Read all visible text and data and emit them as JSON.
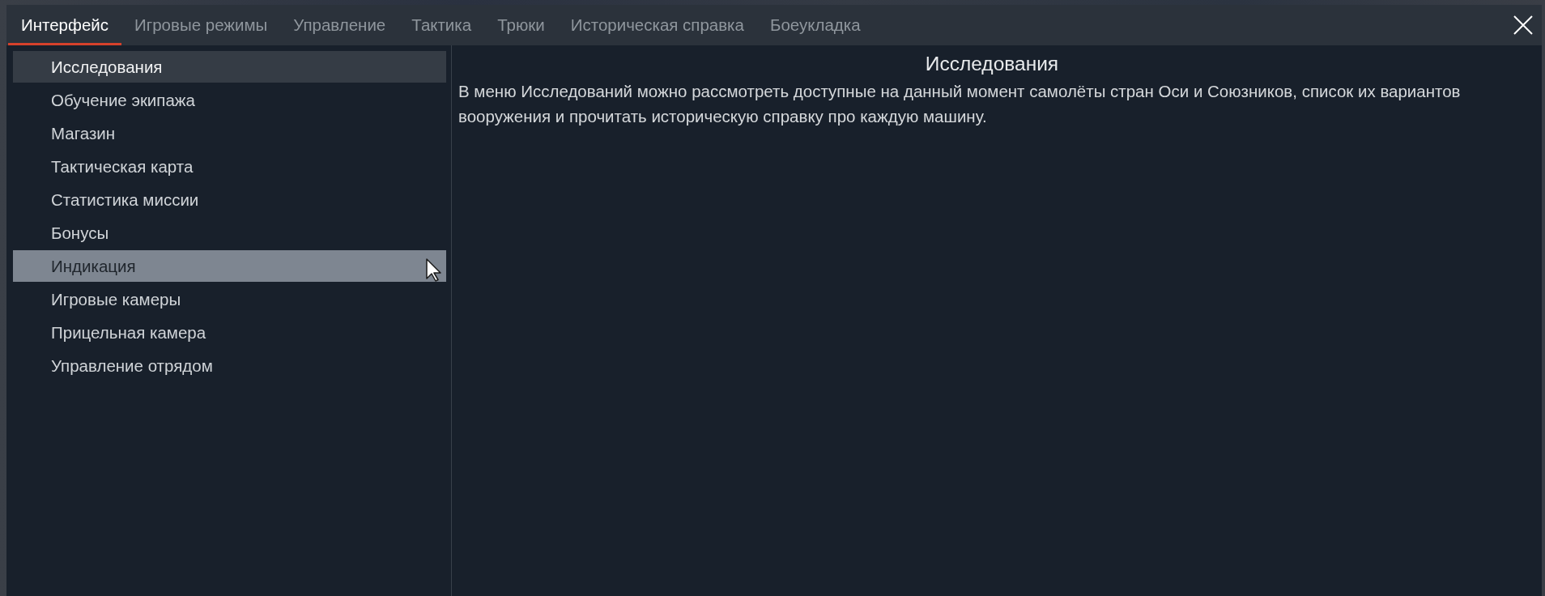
{
  "tabs": [
    {
      "label": "Интерфейс",
      "selected": true
    },
    {
      "label": "Игровые режимы",
      "selected": false
    },
    {
      "label": "Управление",
      "selected": false
    },
    {
      "label": "Тактика",
      "selected": false
    },
    {
      "label": "Трюки",
      "selected": false
    },
    {
      "label": "Историческая справка",
      "selected": false
    },
    {
      "label": "Боеукладка",
      "selected": false
    }
  ],
  "sidebar": {
    "items": [
      {
        "label": "Исследования",
        "selected": true,
        "hovered": false
      },
      {
        "label": "Обучение экипажа",
        "selected": false,
        "hovered": false
      },
      {
        "label": "Магазин",
        "selected": false,
        "hovered": false
      },
      {
        "label": "Тактическая карта",
        "selected": false,
        "hovered": false
      },
      {
        "label": "Статистика миссии",
        "selected": false,
        "hovered": false
      },
      {
        "label": "Бонусы",
        "selected": false,
        "hovered": false
      },
      {
        "label": "Индикация",
        "selected": false,
        "hovered": true
      },
      {
        "label": "Игровые камеры",
        "selected": false,
        "hovered": false
      },
      {
        "label": "Прицельная камера",
        "selected": false,
        "hovered": false
      },
      {
        "label": "Управление отрядом",
        "selected": false,
        "hovered": false
      }
    ]
  },
  "article": {
    "title": "Исследования",
    "body": "В меню Исследований можно рассмотреть доступные на данный момент самолёты стран Оси и Союзников, список их вариантов вооружения и прочитать историческую справку про каждую машину."
  }
}
